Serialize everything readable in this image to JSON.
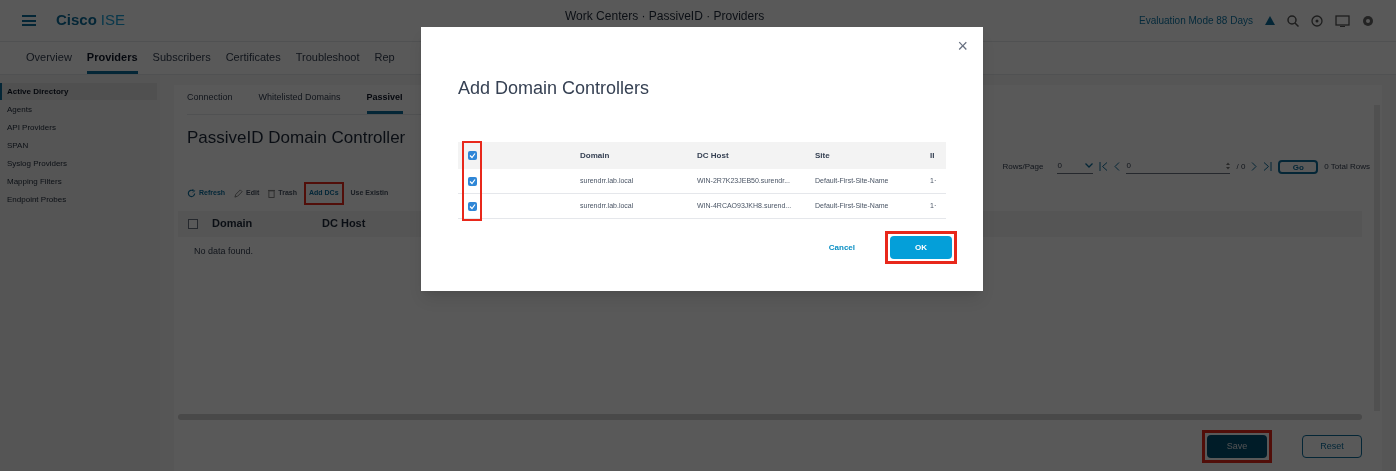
{
  "header": {
    "brand": "Cisco",
    "product": "ISE",
    "title": "Work Centers · PassiveID · Providers",
    "license": "Evaluation Mode 88 Days"
  },
  "nav_tabs": [
    {
      "label": "Overview",
      "selected": false
    },
    {
      "label": "Providers",
      "selected": true
    },
    {
      "label": "Subscribers",
      "selected": false
    },
    {
      "label": "Certificates",
      "selected": false
    },
    {
      "label": "Troubleshoot",
      "selected": false
    },
    {
      "label": "Rep",
      "selected": false
    }
  ],
  "sidebar": {
    "items": [
      {
        "label": "Active Directory",
        "selected": true
      },
      {
        "label": "Agents",
        "selected": false
      },
      {
        "label": "API Providers",
        "selected": false
      },
      {
        "label": "SPAN",
        "selected": false
      },
      {
        "label": "Syslog Providers",
        "selected": false
      },
      {
        "label": "Mapping Filters",
        "selected": false
      },
      {
        "label": "Endpoint Probes",
        "selected": false
      }
    ]
  },
  "sub_tabs": [
    {
      "label": "Connection",
      "selected": false
    },
    {
      "label": "Whitelisted Domains",
      "selected": false
    },
    {
      "label": "PassiveI",
      "selected": true
    }
  ],
  "heading": "PassiveID Domain Controller",
  "toolbar": [
    {
      "kind": "refresh",
      "label": "Refresh",
      "disabled": false,
      "highlighted": false
    },
    {
      "kind": "edit",
      "label": "Edit",
      "disabled": true,
      "highlighted": false
    },
    {
      "kind": "trash",
      "label": "Trash",
      "disabled": true,
      "highlighted": false
    },
    {
      "kind": "text",
      "label": "Add DCs",
      "disabled": false,
      "highlighted": true
    },
    {
      "kind": "text",
      "label": "Use Existin",
      "disabled": true,
      "highlighted": false
    }
  ],
  "table": {
    "header_checked": false,
    "columns": [
      "Domain",
      "DC Host"
    ],
    "empty_text": "No data found."
  },
  "pagination": {
    "rows_label": "Rows/Page",
    "rows_value": "0",
    "page_value": "0",
    "of_pages": "/ 0",
    "go": "Go",
    "total": "0 Total Rows"
  },
  "buttons": [
    {
      "label": "Save",
      "kind": "primary",
      "highlighted": true
    },
    {
      "label": "Reset",
      "kind": "secondary",
      "highlighted": false
    }
  ],
  "dialog": {
    "title": "Add Domain Controllers",
    "close": "×",
    "header_checked": true,
    "checkbox_highlighted": true,
    "columns": [
      "Domain",
      "DC Host",
      "Site",
      "II"
    ],
    "rows": [
      {
        "checked": true,
        "cells": [
          "surendrr.lab.local",
          "WIN-2R7K23JEB50.surendr...",
          "Default-First-Site-Name",
          "1·"
        ]
      },
      {
        "checked": true,
        "cells": [
          "surendrr.lab.local",
          "WIN-4RCAO93JKH8.surend...",
          "Default-First-Site-Name",
          "1·"
        ]
      }
    ],
    "buttons": [
      {
        "label": "Cancel",
        "kind": "link",
        "highlighted": false
      },
      {
        "label": "OK",
        "kind": "primary",
        "highlighted": true
      }
    ]
  }
}
